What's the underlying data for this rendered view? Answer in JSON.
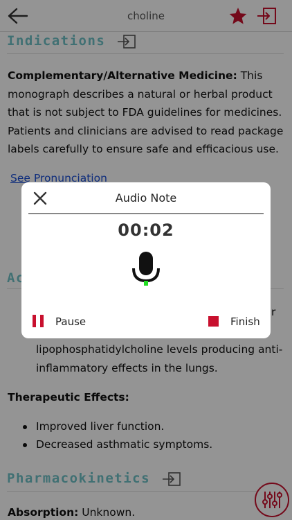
{
  "nav": {
    "title": "choline"
  },
  "sections": {
    "indications": {
      "heading": "Indications",
      "cam_label": "Complementary/Alternative Medicine:",
      "cam_text_1": "This",
      "lines": [
        "monograph describes a natural or herbal product",
        "that is not subject to FDA guidelines for medicines.",
        "Patients and clinicians are advised to read package",
        "labels carefully to ensure safe and efficacious use."
      ],
      "link": "See Pronunciation"
    },
    "action": {
      "heading_partial": "Ac",
      "partial_right": "r",
      "bullet_lines": [
        "lipophosphatidylcholine levels producing anti-",
        "inflammatory effects in the lungs."
      ]
    },
    "therapeutic": {
      "heading": "Therapeutic Effects:",
      "bullets": [
        "Improved liver function.",
        "Decreased asthmatic symptoms."
      ]
    },
    "pharmacokinetics": {
      "heading": "Pharmacokinetics",
      "absorption_label": "Absorption:",
      "absorption_value": "Unknown."
    }
  },
  "modal": {
    "title": "Audio Note",
    "timer": "00:02",
    "pause_label": "Pause",
    "finish_label": "Finish"
  },
  "colors": {
    "accent": "#c8102e",
    "heading": "#6fc2c7",
    "link": "#1a4fd6",
    "mic_level": "#22dd22"
  }
}
